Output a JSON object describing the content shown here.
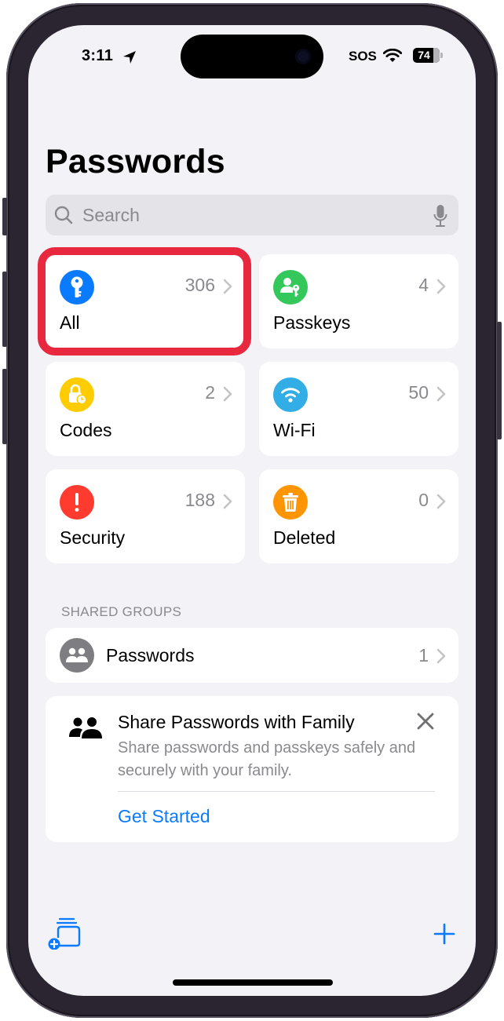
{
  "status_bar": {
    "time": "3:11",
    "location_icon": "location-arrow-icon",
    "carrier": "SOS",
    "wifi_icon": "wifi-icon",
    "battery_level": "74",
    "battery_percent": 74
  },
  "header": {
    "title": "Passwords"
  },
  "search": {
    "placeholder": "Search",
    "icon": "search-icon",
    "mic_icon": "microphone-icon"
  },
  "categories": [
    {
      "label": "All",
      "count": "306",
      "icon": "key-icon",
      "color": "#0a7aff",
      "highlighted": true
    },
    {
      "label": "Passkeys",
      "count": "4",
      "icon": "person-key-icon",
      "color": "#34c759"
    },
    {
      "label": "Codes",
      "count": "2",
      "icon": "lock-clock-icon",
      "color": "#ffcc00"
    },
    {
      "label": "Wi-Fi",
      "count": "50",
      "icon": "wifi-icon",
      "color": "#32ade6"
    },
    {
      "label": "Security",
      "count": "188",
      "icon": "exclamation-icon",
      "color": "#ff3b30"
    },
    {
      "label": "Deleted",
      "count": "0",
      "icon": "trash-icon",
      "color": "#ff9500"
    }
  ],
  "highlight_color": "#e8283e",
  "shared_groups": {
    "header": "SHARED GROUPS",
    "items": [
      {
        "label": "Passwords",
        "count": "1",
        "icon": "people-icon"
      }
    ]
  },
  "promo": {
    "title": "Share Passwords with Family",
    "description": "Share passwords and passkeys safely and securely with your family.",
    "action": "Get Started",
    "icon": "family-icon",
    "close_icon": "close-icon"
  },
  "toolbar": {
    "new_group_icon": "new-group-icon",
    "add_icon": "plus-icon"
  },
  "colors": {
    "accent": "#0a7aff",
    "background": "#f2f2f7",
    "secondary_text": "#8a8a8e"
  }
}
